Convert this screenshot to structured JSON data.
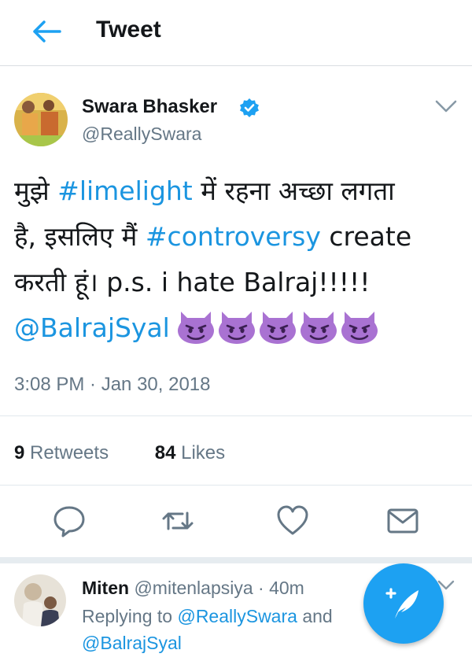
{
  "header": {
    "title": "Tweet",
    "back_icon": "arrow-left-icon"
  },
  "tweet": {
    "author_name": "Swara Bhasker",
    "author_handle": "@ReallySwara",
    "verified": true,
    "text": {
      "line1_part1": "मुझे ",
      "hashtag1": "#limelight",
      "line1_part2": " में रहना अच्छा लगता",
      "line2_part1": "है, इसलिए मैं ",
      "hashtag2": "#controversy",
      "line2_part2": " create",
      "line3": "करती हूं। p.s. i hate Balraj!!!!!",
      "mention": "@BalrajSyal",
      "emoji_name": "smiling-imp-emoji",
      "emoji_count": 5
    },
    "timestamp": "3:08 PM · Jan 30, 2018",
    "retweets_count": "9",
    "retweets_label": "Retweets",
    "likes_count": "84",
    "likes_label": "Likes"
  },
  "actions": [
    "reply-icon",
    "retweet-icon",
    "like-icon",
    "share-icon"
  ],
  "reply": {
    "name": "Miten",
    "handle": "@mitenlapsiya",
    "separator": " · ",
    "time": "40m",
    "replying_prefix": "Replying to ",
    "replying_to_1": "@ReallySwara",
    "replying_and": " and",
    "replying_to_2": "@BalrajSyal"
  },
  "fab_icon": "compose-tweet-icon",
  "colors": {
    "link": "#1b95e0",
    "accent": "#1da1f2",
    "muted": "#657786",
    "emoji": "#a972d2"
  }
}
